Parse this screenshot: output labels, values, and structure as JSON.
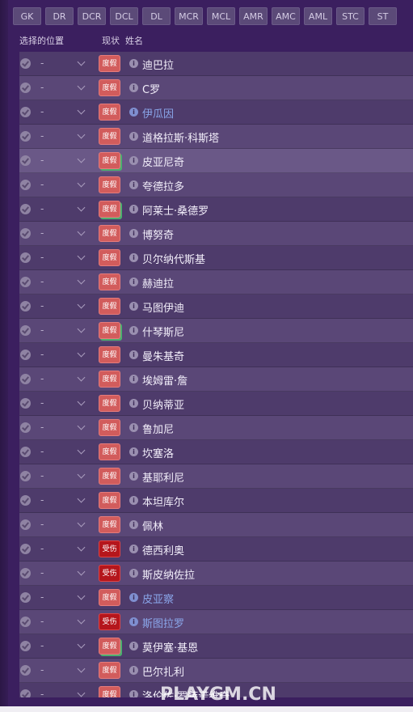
{
  "position_buttons": [
    "GK",
    "DR",
    "DCR",
    "DCL",
    "DL",
    "MCR",
    "MCL",
    "AMR",
    "AMC",
    "AML",
    "STC",
    "ST"
  ],
  "headers": {
    "selected_position": "选择的位置",
    "status": "现状",
    "name": "姓名"
  },
  "rows": [
    {
      "pos": "-",
      "status": "度假",
      "status_type": "holiday",
      "name": "迪巴拉",
      "highlight": false,
      "blue": false,
      "green": false
    },
    {
      "pos": "-",
      "status": "度假",
      "status_type": "holiday",
      "name": "C罗",
      "highlight": false,
      "blue": false,
      "green": false
    },
    {
      "pos": "-",
      "status": "度假",
      "status_type": "holiday",
      "name": "伊瓜因",
      "highlight": false,
      "blue": true,
      "green": false
    },
    {
      "pos": "-",
      "status": "度假",
      "status_type": "holiday",
      "name": "道格拉斯·科斯塔",
      "highlight": false,
      "blue": false,
      "green": false
    },
    {
      "pos": "-",
      "status": "度假",
      "status_type": "holiday",
      "name": "皮亚尼奇",
      "highlight": true,
      "blue": false,
      "green": true
    },
    {
      "pos": "-",
      "status": "度假",
      "status_type": "holiday",
      "name": "夸德拉多",
      "highlight": false,
      "blue": false,
      "green": false
    },
    {
      "pos": "-",
      "status": "度假",
      "status_type": "holiday",
      "name": "阿莱士·桑德罗",
      "highlight": false,
      "blue": false,
      "green": true
    },
    {
      "pos": "-",
      "status": "度假",
      "status_type": "holiday",
      "name": "博努奇",
      "highlight": false,
      "blue": false,
      "green": false
    },
    {
      "pos": "-",
      "status": "度假",
      "status_type": "holiday",
      "name": "贝尔纳代斯基",
      "highlight": false,
      "blue": false,
      "green": false
    },
    {
      "pos": "-",
      "status": "度假",
      "status_type": "holiday",
      "name": "赫迪拉",
      "highlight": false,
      "blue": false,
      "green": false
    },
    {
      "pos": "-",
      "status": "度假",
      "status_type": "holiday",
      "name": "马图伊迪",
      "highlight": false,
      "blue": false,
      "green": false
    },
    {
      "pos": "-",
      "status": "度假",
      "status_type": "holiday",
      "name": "什琴斯尼",
      "highlight": false,
      "blue": false,
      "green": true
    },
    {
      "pos": "-",
      "status": "度假",
      "status_type": "holiday",
      "name": "曼朱基奇",
      "highlight": false,
      "blue": false,
      "green": false
    },
    {
      "pos": "-",
      "status": "度假",
      "status_type": "holiday",
      "name": "埃姆雷·詹",
      "highlight": false,
      "blue": false,
      "green": false
    },
    {
      "pos": "-",
      "status": "度假",
      "status_type": "holiday",
      "name": "贝纳蒂亚",
      "highlight": false,
      "blue": false,
      "green": false
    },
    {
      "pos": "-",
      "status": "度假",
      "status_type": "holiday",
      "name": "鲁加尼",
      "highlight": false,
      "blue": false,
      "green": false
    },
    {
      "pos": "-",
      "status": "度假",
      "status_type": "holiday",
      "name": "坎塞洛",
      "highlight": false,
      "blue": false,
      "green": false
    },
    {
      "pos": "-",
      "status": "度假",
      "status_type": "holiday",
      "name": "基耶利尼",
      "highlight": false,
      "blue": false,
      "green": false
    },
    {
      "pos": "-",
      "status": "度假",
      "status_type": "holiday",
      "name": "本坦库尔",
      "highlight": false,
      "blue": false,
      "green": false
    },
    {
      "pos": "-",
      "status": "度假",
      "status_type": "holiday",
      "name": "佩林",
      "highlight": false,
      "blue": false,
      "green": false
    },
    {
      "pos": "-",
      "status": "受伤",
      "status_type": "injured",
      "name": "德西利奥",
      "highlight": false,
      "blue": false,
      "green": false
    },
    {
      "pos": "-",
      "status": "受伤",
      "status_type": "injured",
      "name": "斯皮纳佐拉",
      "highlight": false,
      "blue": false,
      "green": false
    },
    {
      "pos": "-",
      "status": "度假",
      "status_type": "holiday",
      "name": "皮亚察",
      "highlight": false,
      "blue": true,
      "green": false
    },
    {
      "pos": "-",
      "status": "受伤",
      "status_type": "injured",
      "name": "斯图拉罗",
      "highlight": false,
      "blue": true,
      "green": false
    },
    {
      "pos": "-",
      "status": "度假",
      "status_type": "holiday",
      "name": "莫伊塞·基恩",
      "highlight": false,
      "blue": false,
      "green": true
    },
    {
      "pos": "-",
      "status": "度假",
      "status_type": "holiday",
      "name": "巴尔扎利",
      "highlight": false,
      "blue": false,
      "green": false
    },
    {
      "pos": "-",
      "status": "度假",
      "status_type": "holiday",
      "name": "洛伦佐·罗萨诺维奇",
      "highlight": false,
      "blue": false,
      "green": false
    }
  ],
  "watermark": "PLAYGM.CN",
  "colors": {
    "background": "#3a1f5c",
    "holiday_badge": "#d25c5c",
    "injured_badge": "#b5161c",
    "blue_name": "#8aa6ea",
    "green_marker": "#4caf6e"
  }
}
